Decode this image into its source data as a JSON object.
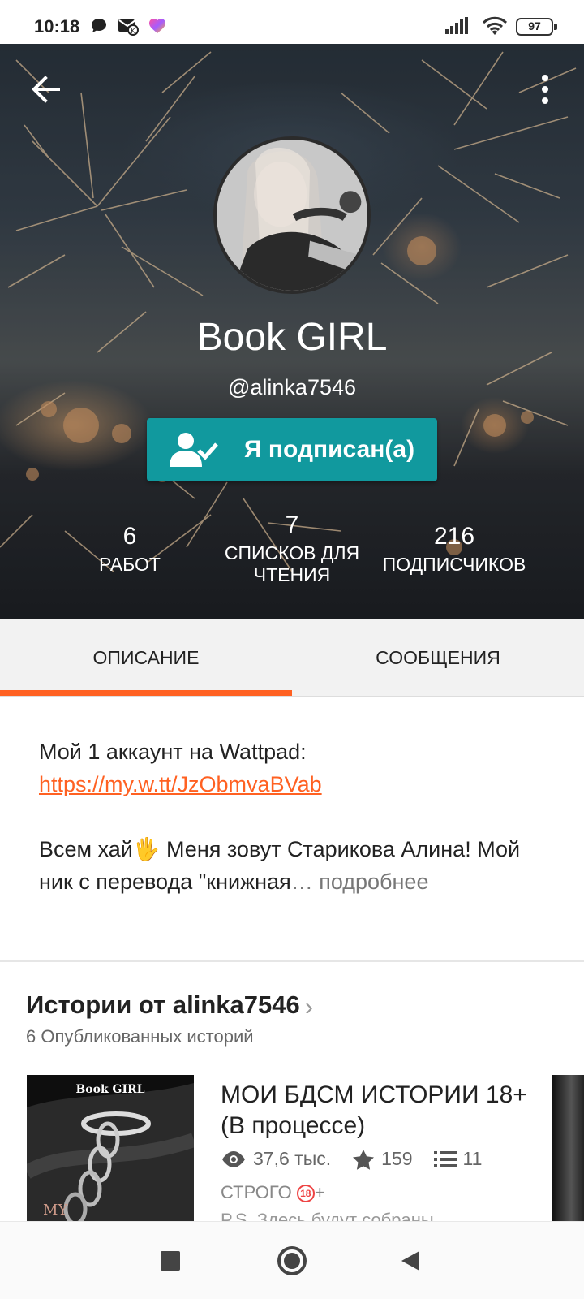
{
  "status_bar": {
    "time": "10:18",
    "battery": "97",
    "notification_icons": [
      "chat-bubble-icon",
      "mail-badge-icon",
      "heart-app-icon"
    ],
    "system_icons": [
      "signal-icon",
      "wifi-icon",
      "battery-icon"
    ]
  },
  "profile": {
    "display_name": "Book GIRL",
    "username": "@alinka7546",
    "follow_button_label": "Я подписан(а)",
    "stats": [
      {
        "value": "6",
        "label": "РАБОТ"
      },
      {
        "value": "7",
        "label": "СПИСКОВ ДЛЯ ЧТЕНИЯ"
      },
      {
        "value": "216",
        "label": "ПОДПИСЧИКОВ"
      }
    ]
  },
  "tabs": [
    {
      "label": "ОПИСАНИЕ",
      "active": true
    },
    {
      "label": "СООБЩЕНИЯ",
      "active": false
    }
  ],
  "description": {
    "line1": "Мой 1 аккаунт на Wattpad:",
    "link": "https://my.w.tt/JzObmvaBVab",
    "text": "Всем хай🖐 Меня зовут Старикова Алина! Мой ник с перевода \"книжная",
    "ellipsis": "…",
    "more": " подробнее"
  },
  "stories_section": {
    "title": "Истории от alinka7546",
    "subtitle": "6 Опубликованных историй",
    "story": {
      "cover_title": "Book GIRL",
      "cover_subtext": "MY",
      "title": "МОИ БДСМ ИСТОРИИ 18+ (В процессе)",
      "views": "37,6 тыс.",
      "votes": "159",
      "parts": "11",
      "rating_label": "СТРОГО ",
      "rating_badge": "18",
      "rating_suffix": "+",
      "preview": "P.S. Здесь будут собраны"
    }
  },
  "colors": {
    "accent": "#ff6122",
    "follow_button": "#11999e"
  }
}
